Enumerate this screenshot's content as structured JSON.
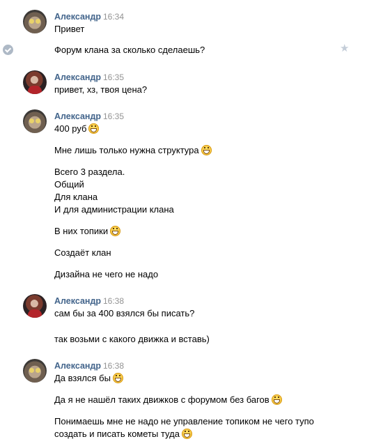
{
  "groups": [
    {
      "author": "Александр",
      "time": "16:34",
      "avatar": "cat-avatar",
      "messages": [
        "Привет",
        "Форум клана за сколько сделаешь?"
      ]
    },
    {
      "author": "Александр",
      "time": "16:35",
      "avatar": "person-avatar",
      "messages": [
        "привет, хз, твоя цена?"
      ]
    },
    {
      "author": "Александр",
      "time": "16:35",
      "avatar": "cat-avatar",
      "messages": [
        "400 руб",
        "Мне лишь только нужна структура",
        "Всего 3 раздела.",
        "Общий",
        "Для клана",
        "И для администрации клана",
        "В них топики",
        "Создаёт клан",
        "Дизайна не чего не надо"
      ]
    },
    {
      "author": "Александр",
      "time": "16:38",
      "avatar": "person-avatar",
      "messages": [
        "сам бы за 400 взялся бы писать?",
        "так возьми с какого движка и вставь)"
      ]
    },
    {
      "author": "Александр",
      "time": "16:38",
      "avatar": "cat-avatar",
      "messages": [
        "Да взялся бы",
        "Да я не нашёл таких движков с форумом без багов",
        "Понимаешь мне не надо не управление топиком не чего тупо",
        "создать и писать кометы туда"
      ]
    }
  ],
  "icons": {
    "check": "check-icon",
    "star": "star-icon",
    "emoji": "grinning-emoji-icon"
  }
}
